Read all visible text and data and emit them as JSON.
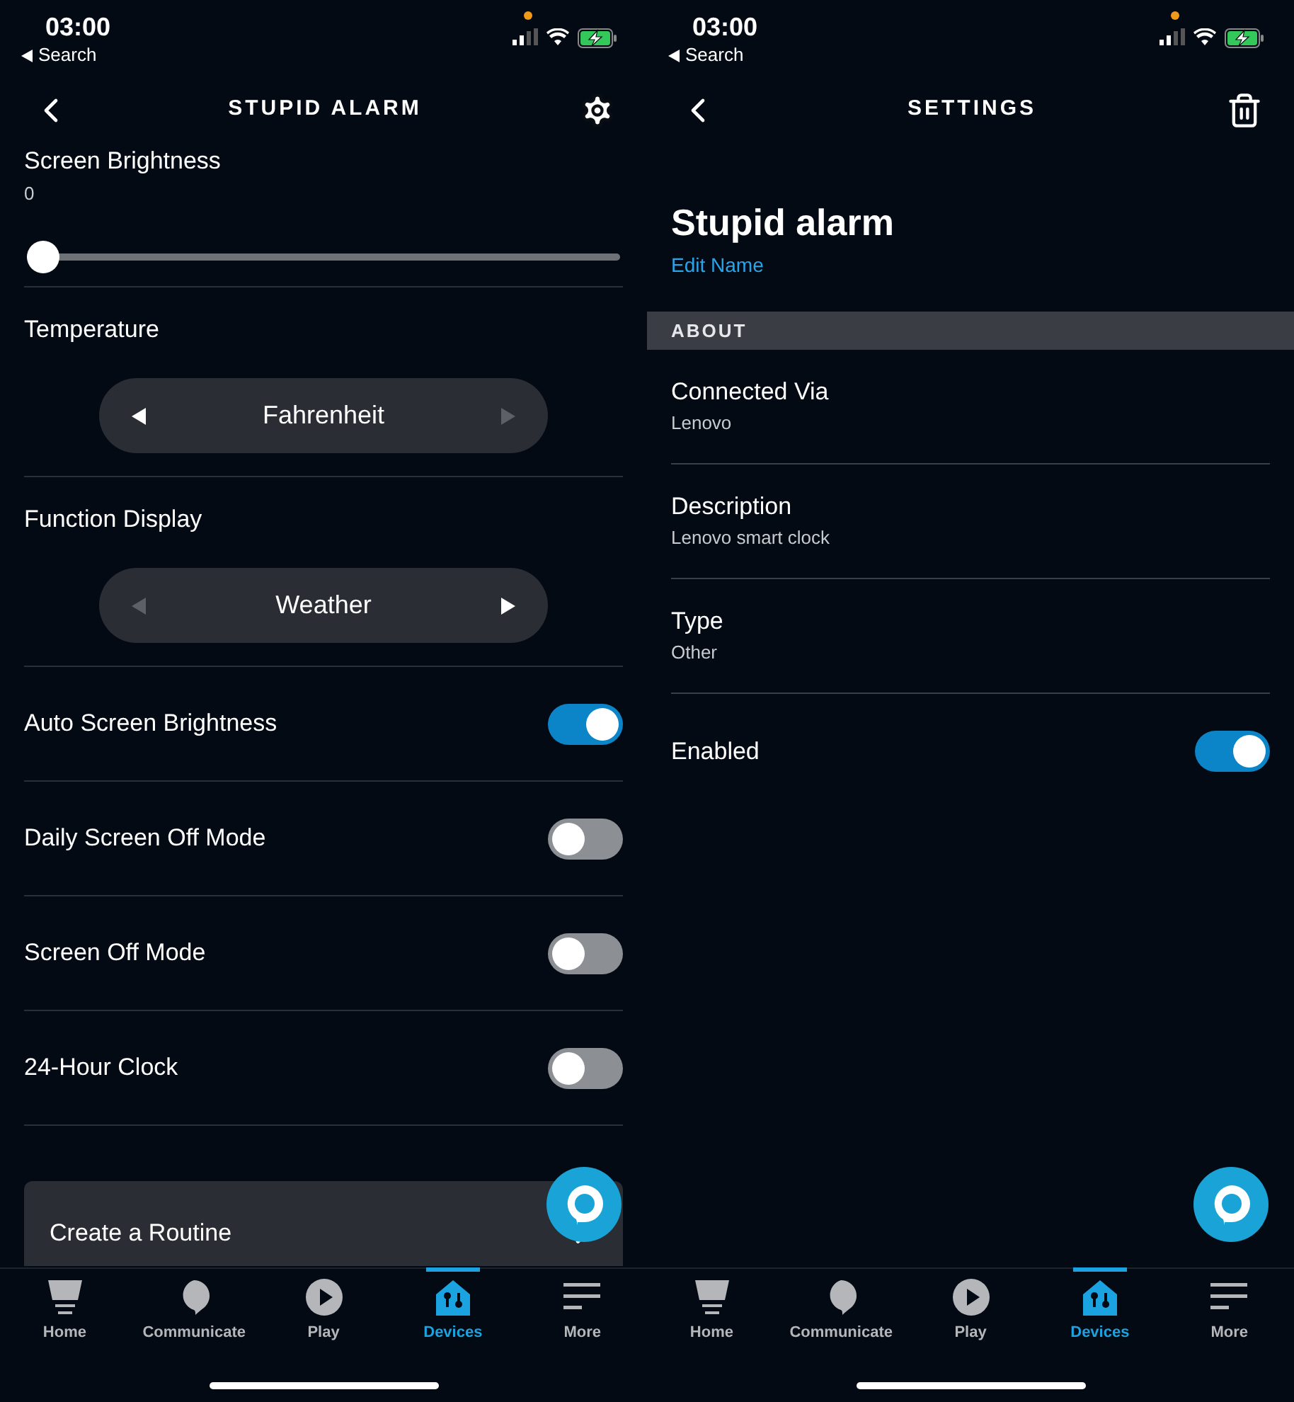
{
  "screens": [
    {
      "status_bar": {
        "time": "03:00",
        "back_label": "Search"
      },
      "header": {
        "title": "STUPID ALARM",
        "action": {
          "kind": "gear"
        }
      },
      "content": {
        "kind": "device_settings",
        "rows": [
          {
            "kind": "slider",
            "label": "Screen Brightness",
            "reading": "0",
            "level": 0
          },
          {
            "kind": "stepper",
            "label": "Temperature",
            "value": "Fahrenheit",
            "prev_disabled": false,
            "next_disabled": true
          },
          {
            "kind": "stepper",
            "label": "Function Display",
            "value": "Weather",
            "prev_disabled": true,
            "next_disabled": false
          },
          {
            "kind": "toggle",
            "label": "Auto Screen Brightness",
            "on": true
          },
          {
            "kind": "toggle",
            "label": "Daily Screen Off Mode",
            "on": false
          },
          {
            "kind": "toggle",
            "label": "Screen Off Mode",
            "on": false
          },
          {
            "kind": "toggle",
            "label": "24-Hour Clock",
            "on": false
          }
        ],
        "card": {
          "label": "Create a Routine"
        }
      },
      "nav": [
        {
          "label": "Home",
          "selected": false
        },
        {
          "label": "Communicate",
          "selected": false
        },
        {
          "label": "Play",
          "selected": false
        },
        {
          "label": "Devices",
          "selected": true
        },
        {
          "label": "More",
          "selected": false
        }
      ]
    },
    {
      "status_bar": {
        "time": "03:00",
        "back_label": "Search"
      },
      "header": {
        "title": "SETTINGS",
        "action": {
          "kind": "trash"
        }
      },
      "content": {
        "kind": "about",
        "name": "Stupid alarm",
        "edit_link": "Edit Name",
        "section": "ABOUT",
        "rows": [
          {
            "kind": "info",
            "label": "Connected Via",
            "value": "Lenovo"
          },
          {
            "kind": "info",
            "label": "Description",
            "value": "Lenovo smart clock"
          },
          {
            "kind": "info",
            "label": "Type",
            "value": "Other"
          },
          {
            "kind": "toggle",
            "label": "Enabled",
            "on": true
          }
        ]
      },
      "nav": [
        {
          "label": "Home",
          "selected": false
        },
        {
          "label": "Communicate",
          "selected": false
        },
        {
          "label": "Play",
          "selected": false
        },
        {
          "label": "Devices",
          "selected": true
        },
        {
          "label": "More",
          "selected": false
        }
      ]
    }
  ]
}
